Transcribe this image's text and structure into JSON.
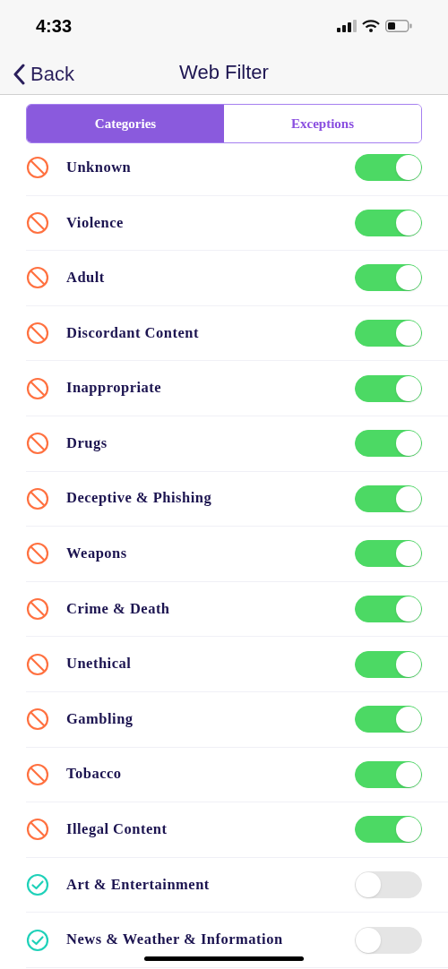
{
  "status_bar": {
    "time": "4:33"
  },
  "nav": {
    "back": "Back",
    "title": "Web Filter"
  },
  "tabs": [
    {
      "label": "Categories",
      "selected": true
    },
    {
      "label": "Exceptions",
      "selected": false
    }
  ],
  "categories": [
    {
      "label": "Unknown",
      "on": true
    },
    {
      "label": "Violence",
      "on": true
    },
    {
      "label": "Adult",
      "on": true
    },
    {
      "label": "Discordant Content",
      "on": true
    },
    {
      "label": "Inappropriate",
      "on": true
    },
    {
      "label": "Drugs",
      "on": true
    },
    {
      "label": "Deceptive & Phishing",
      "on": true
    },
    {
      "label": "Weapons",
      "on": true
    },
    {
      "label": "Crime & Death",
      "on": true
    },
    {
      "label": "Unethical",
      "on": true
    },
    {
      "label": "Gambling",
      "on": true
    },
    {
      "label": "Tobacco",
      "on": true
    },
    {
      "label": "Illegal Content",
      "on": true
    },
    {
      "label": "Art & Entertainment",
      "on": false
    },
    {
      "label": "News & Weather & Information",
      "on": false
    }
  ]
}
